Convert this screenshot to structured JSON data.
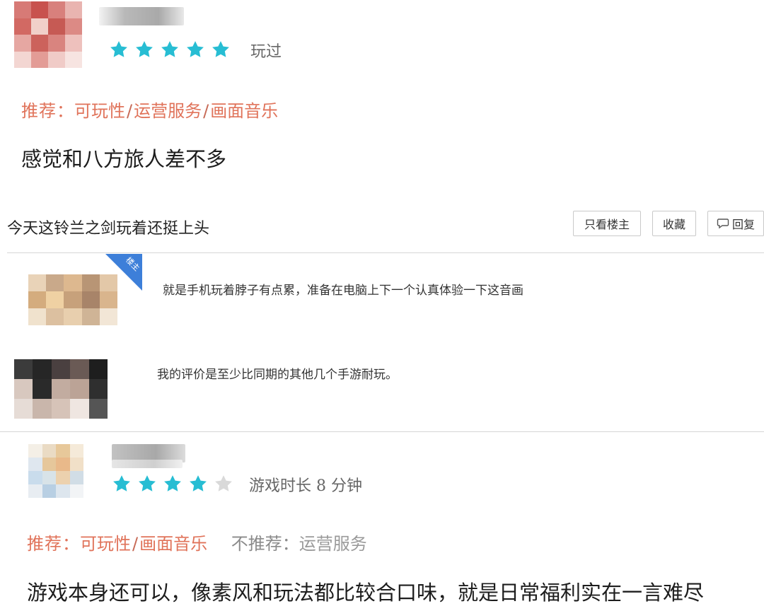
{
  "review1": {
    "status": "玩过",
    "rating": 5,
    "max_rating": 5,
    "recommend_label": "推荐：",
    "recommend_tags": [
      "可玩性",
      "运营服务",
      "画面音乐"
    ],
    "text": "感觉和八方旅人差不多"
  },
  "thread": {
    "title": "今天这铃兰之剑玩着还挺上头",
    "buttons": {
      "only_op": "只看楼主",
      "favorite": "收藏",
      "reply": "回复"
    },
    "op_badge": "楼主",
    "replies": [
      {
        "text": "就是手机玩着脖子有点累，准备在电脑上下一个认真体验一下这音画"
      },
      {
        "text": "我的评价是至少比同期的其他几个手游耐玩。"
      }
    ]
  },
  "review2": {
    "status": "游戏时长 8 分钟",
    "rating": 4,
    "max_rating": 5,
    "recommend_label": "推荐：",
    "recommend_tags": [
      "可玩性",
      "画面音乐"
    ],
    "not_recommend_label": "不推荐：",
    "not_recommend_tags": [
      "运营服务"
    ],
    "text": "游戏本身还可以，像素风和玩法都比较合口味，就是日常福利实在一言难尽"
  },
  "colors": {
    "star_filled": "#27bdd3",
    "star_empty": "#d9d9d9",
    "recommend": "#e0735a",
    "op_badge": "#3d7fd9"
  }
}
